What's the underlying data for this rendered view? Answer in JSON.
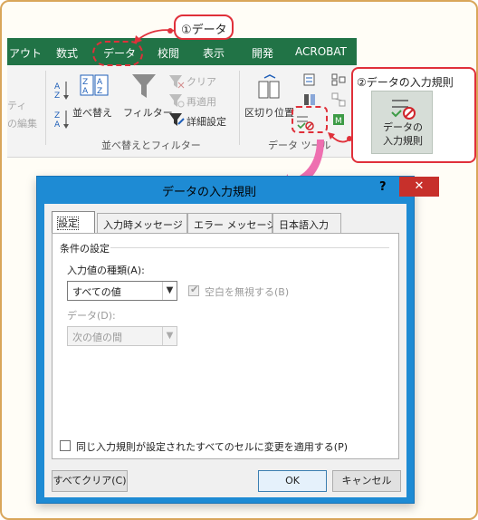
{
  "ribbon": {
    "tabs": [
      "アウト",
      "数式",
      "データ",
      "校閲",
      "表示",
      "開発",
      "ACROBAT"
    ],
    "sort_filter": {
      "sort_label": "並べ替え",
      "filter_label": "フィルター",
      "clear_label": "クリア",
      "reapply_label": "再適用",
      "advanced_label": "詳細設定",
      "group_label": "並べ替えとフィルター",
      "left_fragment_1": "ティ",
      "left_fragment_2": "の編集"
    },
    "data_tools": {
      "text_to_columns_label": "区切り位置",
      "group_label": "データ ツール"
    }
  },
  "callouts": {
    "step1": "①データ",
    "step2": "②データの入力規則",
    "dv_button_label_line1": "データの",
    "dv_button_label_line2": "入力規則"
  },
  "dialog": {
    "title": "データの入力規則",
    "help": "?",
    "close": "✕",
    "tabs": [
      "設定",
      "入力時メッセージ",
      "エラー メッセージ",
      "日本語入力"
    ],
    "fieldset_label": "条件の設定",
    "allow_label": "入力値の種類(A):",
    "allow_value": "すべての値",
    "ignore_blank_label": "空白を無視する(B)",
    "data_label": "データ(D):",
    "data_value": "次の値の間",
    "apply_all_label": "同じ入力規則が設定されたすべてのセルに変更を適用する(P)",
    "clear_all_button": "すべてクリア(C)",
    "ok_button": "OK",
    "cancel_button": "キャンセル"
  },
  "colors": {
    "ribbon_green": "#217346",
    "callout_red": "#e0303a",
    "dialog_border": "#1e8bd4",
    "close_red": "#c7302b",
    "arrow_pink": "#ee6fb0"
  }
}
